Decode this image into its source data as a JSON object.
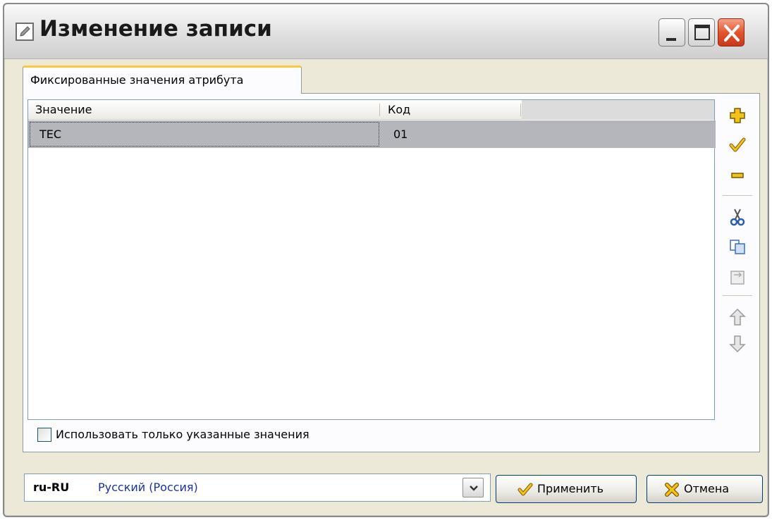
{
  "window": {
    "title": "Изменение записи"
  },
  "titlebar_buttons": {
    "minimize": "minimize-icon",
    "maximize": "maximize-icon",
    "close": "close-icon"
  },
  "tabs": [
    {
      "label": "Фиксированные значения атрибута",
      "active": true
    }
  ],
  "grid": {
    "columns": [
      "Значение",
      "Код"
    ],
    "rows": [
      {
        "value": "TEC",
        "code": "01",
        "selected": true
      }
    ]
  },
  "side_toolbar": {
    "icons": [
      "add-icon",
      "check-icon",
      "remove-icon",
      "cut-icon",
      "copy-icon",
      "paste-icon",
      "arrow-up-icon",
      "arrow-down-icon"
    ]
  },
  "checkbox": {
    "label": "Использовать только указанные значения",
    "checked": false
  },
  "language": {
    "code": "ru-RU",
    "name": "Русский (Россия)"
  },
  "buttons": {
    "apply": "Применить",
    "cancel": "Отмена"
  },
  "colors": {
    "tab_accent": "#ffc83c",
    "selected_row": "#b5b5bc",
    "close_button": "#e4552d",
    "window_bg": "#ece9d8"
  }
}
